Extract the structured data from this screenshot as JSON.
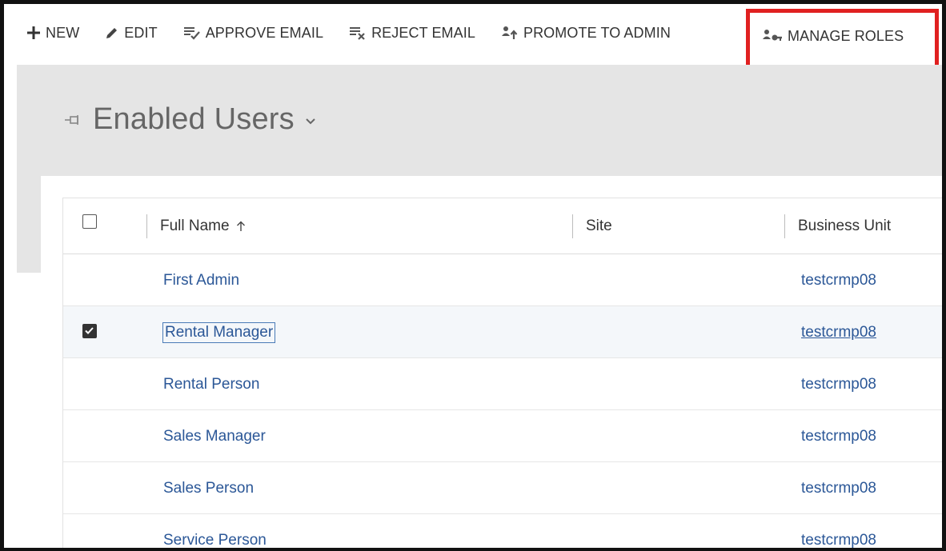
{
  "toolbar": {
    "new_label": "NEW",
    "edit_label": "EDIT",
    "approve_email_label": "APPROVE EMAIL",
    "reject_email_label": "REJECT EMAIL",
    "promote_label": "PROMOTE TO ADMIN",
    "manage_roles_label": "MANAGE ROLES",
    "highlight_color": "#e02020"
  },
  "view": {
    "title": "Enabled Users"
  },
  "grid": {
    "columns": {
      "full_name": "Full Name",
      "site": "Site",
      "business_unit": "Business Unit"
    },
    "sort_indicator": "↑",
    "rows": [
      {
        "full_name": "First Admin",
        "site": "",
        "business_unit": "testcrmp08",
        "checked": false
      },
      {
        "full_name": "Rental Manager",
        "site": "",
        "business_unit": "testcrmp08",
        "checked": true
      },
      {
        "full_name": "Rental Person",
        "site": "",
        "business_unit": "testcrmp08",
        "checked": false
      },
      {
        "full_name": "Sales Manager",
        "site": "",
        "business_unit": "testcrmp08",
        "checked": false
      },
      {
        "full_name": "Sales Person",
        "site": "",
        "business_unit": "testcrmp08",
        "checked": false
      },
      {
        "full_name": "Service Person",
        "site": "",
        "business_unit": "testcrmp08",
        "checked": false
      }
    ]
  },
  "colors": {
    "link": "#2b5797",
    "gray_background": "#e5e5e5"
  }
}
